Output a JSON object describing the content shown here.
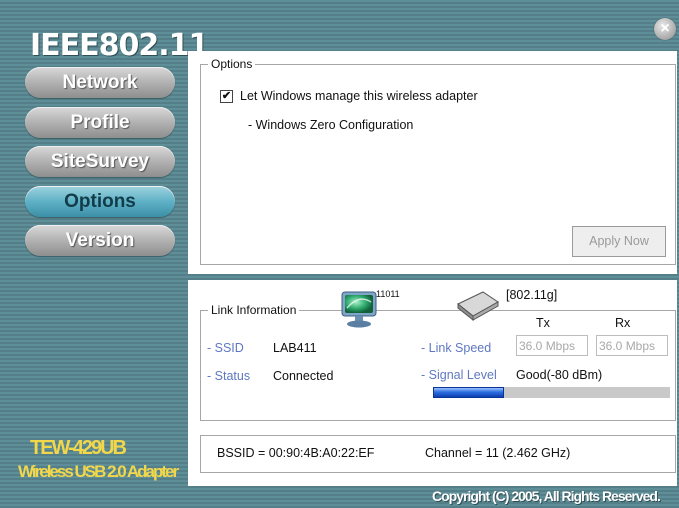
{
  "brand": {
    "title": "IEEE802.11",
    "model": "TEW-429UB",
    "description": "Wireless USB 2.0 Adapter",
    "copyright": "Copyright (C) 2005, All Rights Reserved."
  },
  "nav": {
    "items": [
      {
        "label": "Network",
        "active": false
      },
      {
        "label": "Profile",
        "active": false
      },
      {
        "label": "SiteSurvey",
        "active": false
      },
      {
        "label": "Options",
        "active": true
      },
      {
        "label": "Version",
        "active": false
      }
    ]
  },
  "options": {
    "legend": "Options",
    "checkbox_label": "Let Windows manage this wireless adapter",
    "checkbox_checked": true,
    "checkbox_mark": "✔",
    "note": "- Windows Zero Configuration",
    "apply_label": "Apply Now"
  },
  "link": {
    "legend": "Link Information",
    "computer_number": "11011",
    "mode": "[802.11g]",
    "tx_header": "Tx",
    "rx_header": "Rx",
    "ssid_label": "- SSID",
    "ssid_value": "LAB411",
    "status_label": "- Status",
    "status_value": "Connected",
    "speed_label": "- Link Speed",
    "tx_speed": "36.0 Mbps",
    "rx_speed": "36.0 Mbps",
    "signal_label": "- Signal Level",
    "signal_value": "Good(-80 dBm)",
    "signal_fraction": 0.3
  },
  "footer": {
    "bssid": "BSSID = 00:90:4B:A0:22:EF",
    "channel": "Channel = 11 (2.462 GHz)"
  },
  "colors": {
    "background": "#5e8e98",
    "active_nav": "#5fb1c6",
    "label_blue": "#5f78c0",
    "signal_blue": "#2e6fe0",
    "model_yellow": "#f2d74b"
  },
  "icons": {
    "close": "close-icon",
    "computer": "computer-icon",
    "adapter": "usb-adapter-icon"
  }
}
